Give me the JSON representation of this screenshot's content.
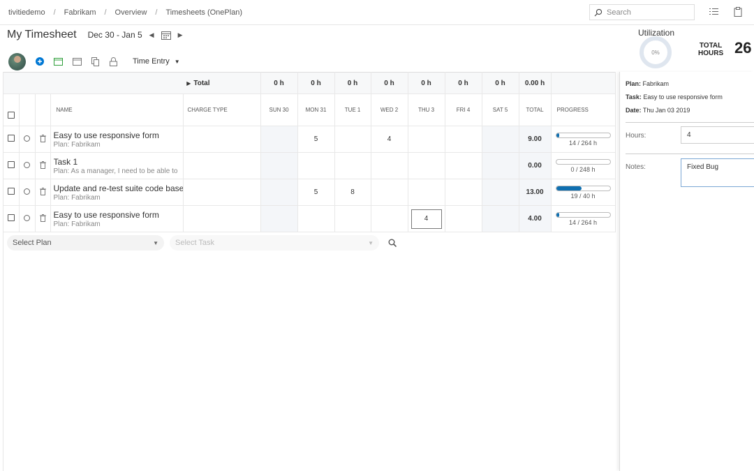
{
  "breadcrumb": [
    "tivitiedemo",
    "Fabrikam",
    "Overview",
    "Timesheets (OnePlan)"
  ],
  "search": {
    "placeholder": "Search"
  },
  "header": {
    "title": "My Timesheet",
    "date_range": "Dec 30 - Jan 5"
  },
  "toolbar": {
    "view_label": "Time Entry"
  },
  "utilization": {
    "label": "Utilization",
    "percent": "0%"
  },
  "total_hours": {
    "label_line1": "TOTAL",
    "label_line2": "HOURS",
    "value": "26"
  },
  "grid": {
    "totals_label": "Total",
    "day_totals": [
      "0 h",
      "0 h",
      "0 h",
      "0 h",
      "0 h",
      "0 h",
      "0 h",
      "0.00 h"
    ],
    "columns": {
      "name": "NAME",
      "charge_type": "CHARGE TYPE",
      "days": [
        "SUN 30",
        "MON 31",
        "TUE 1",
        "WED 2",
        "THU 3",
        "FRI 4",
        "SAT 5"
      ],
      "total": "TOTAL",
      "progress": "PROGRESS"
    },
    "rows": [
      {
        "title": "Easy to use responsive form",
        "plan": "Plan: Fabrikam",
        "mon": "5",
        "tue": "",
        "wed": "4",
        "thu": "",
        "total": "9.00",
        "progress_text": "14 / 264 h",
        "progress": 0.053
      },
      {
        "title": "Task 1",
        "plan": "Plan: As a manager, I need to be able to",
        "mon": "",
        "tue": "",
        "wed": "",
        "thu": "",
        "total": "0.00",
        "progress_text": "0 / 248 h",
        "progress": 0
      },
      {
        "title": "Update and re-test suite code base",
        "plan": "Plan: Fabrikam",
        "mon": "5",
        "tue": "8",
        "wed": "",
        "thu": "",
        "total": "13.00",
        "progress_text": "19 / 40 h",
        "progress": 0.475
      },
      {
        "title": "Easy to use responsive form",
        "plan": "Plan: Fabrikam",
        "mon": "",
        "tue": "",
        "wed": "",
        "thu": "4",
        "total": "4.00",
        "progress_text": "14 / 264 h",
        "progress": 0.053
      }
    ]
  },
  "adder": {
    "plan_placeholder": "Select Plan",
    "task_placeholder": "Select Task"
  },
  "details": {
    "plan_label": "Plan:",
    "plan_value": "Fabrikam",
    "task_label": "Task:",
    "task_value": "Easy to use responsive form",
    "date_label": "Date:",
    "date_value": "Thu Jan 03 2019",
    "hours_label": "Hours:",
    "hours_value": "4",
    "notes_label": "Notes:",
    "notes_value": "Fixed Bug"
  },
  "colors": {
    "accent": "#0f6fb0",
    "add_icon": "#0078d4",
    "calendar_icon": "#2e9e3a"
  },
  "icons": [
    "search-icon",
    "list-icon",
    "clipboard-icon",
    "calendar-icon",
    "add-icon",
    "calendar-check-icon",
    "window-icon",
    "copy-icon",
    "lock-icon",
    "trash-icon"
  ]
}
